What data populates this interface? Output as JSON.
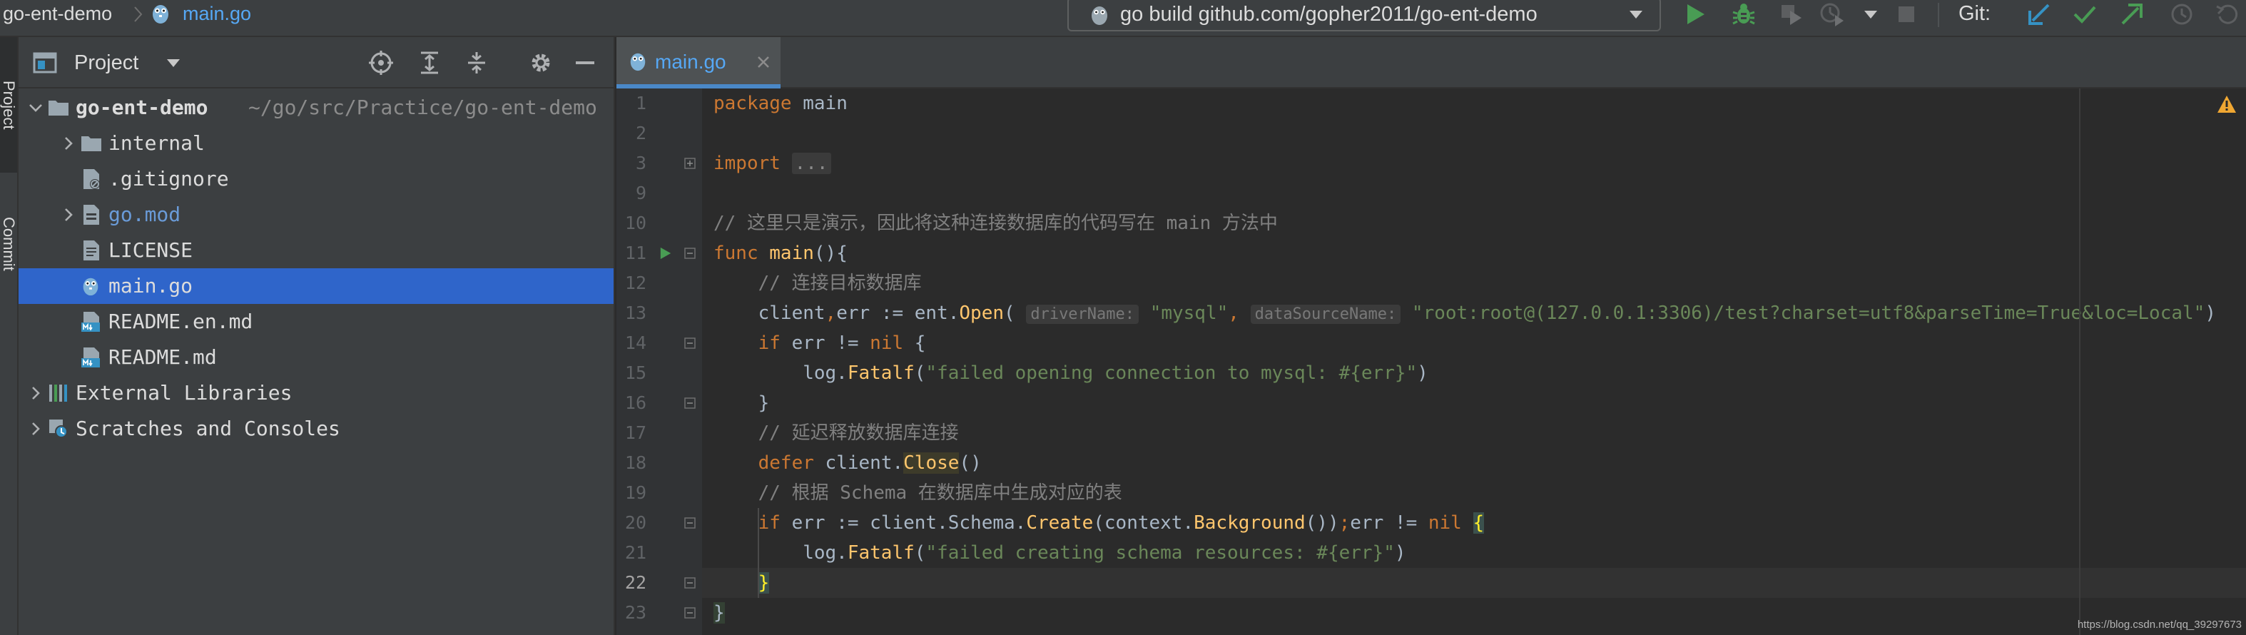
{
  "topbar": {
    "project_crumb": "go-ent-demo",
    "file_crumb": "main.go",
    "run_config": "go build github.com/gopher2011/go-ent-demo",
    "vcs_label": "Git:"
  },
  "tool_stripe": {
    "project_tab": "Project",
    "commit_tab": "Commit"
  },
  "project_panel": {
    "title": "Project",
    "tree": [
      {
        "label": "go-ent-demo",
        "path": "~/go/src/Practice/go-ent-demo",
        "icon": "folder-icon",
        "expandable": true,
        "expanded": true,
        "level": 0
      },
      {
        "label": "internal",
        "icon": "folder-icon",
        "expandable": true,
        "expanded": false,
        "level": 1
      },
      {
        "label": ".gitignore",
        "icon": "ignore-file-icon",
        "expandable": false,
        "level": 1
      },
      {
        "label": "go.mod",
        "icon": "go-mod-icon",
        "expandable": true,
        "expanded": false,
        "level": 1
      },
      {
        "label": "LICENSE",
        "icon": "text-file-icon",
        "expandable": false,
        "level": 1
      },
      {
        "label": "main.go",
        "icon": "gopher-file-icon",
        "expandable": false,
        "level": 1,
        "selected": true
      },
      {
        "label": "README.en.md",
        "icon": "markdown-icon",
        "expandable": false,
        "level": 1
      },
      {
        "label": "README.md",
        "icon": "markdown-icon",
        "expandable": false,
        "level": 1
      },
      {
        "label": "External Libraries",
        "icon": "libraries-icon",
        "expandable": true,
        "expanded": false,
        "level": 0
      },
      {
        "label": "Scratches and Consoles",
        "icon": "scratches-icon",
        "expandable": true,
        "expanded": false,
        "level": 0
      }
    ]
  },
  "editor": {
    "tab_label": "main.go",
    "current_line": "22",
    "lines": [
      {
        "no": "1",
        "segs": [
          [
            "kw",
            "package"
          ],
          [
            "",
            " main"
          ]
        ]
      },
      {
        "no": "2",
        "segs": []
      },
      {
        "no": "3",
        "segs": [
          [
            "kw",
            "import"
          ],
          [
            "",
            " "
          ],
          [
            "fold",
            "..."
          ]
        ]
      },
      {
        "no": "9",
        "segs": []
      },
      {
        "no": "10",
        "segs": [
          [
            "cmt",
            "// 这里只是演示，因此将这种连接数据库的代码写在 main 方法中"
          ]
        ]
      },
      {
        "no": "11",
        "segs": [
          [
            "kw",
            "func"
          ],
          [
            "",
            " "
          ],
          [
            "fn",
            "main"
          ],
          [
            "",
            "(){"
          ]
        ]
      },
      {
        "no": "12",
        "segs": [
          [
            "",
            "    "
          ],
          [
            "cmt",
            "// 连接目标数据库"
          ]
        ]
      },
      {
        "no": "13",
        "segs": [
          [
            "",
            "    client"
          ],
          [
            "kw",
            ","
          ],
          [
            "",
            "err := ent."
          ],
          [
            "fn",
            "Open"
          ],
          [
            "",
            "( "
          ],
          [
            "hint",
            "driverName:"
          ],
          [
            "",
            " "
          ],
          [
            "str",
            "\"mysql\""
          ],
          [
            "kw",
            ","
          ],
          [
            "",
            " "
          ],
          [
            "hint",
            "dataSourceName:"
          ],
          [
            "",
            " "
          ],
          [
            "str",
            "\"root:root@(127.0.0.1:3306)/test?charset=utf8&parseTime=True&loc=Local\""
          ],
          [
            "",
            ")"
          ]
        ]
      },
      {
        "no": "14",
        "segs": [
          [
            "",
            "    "
          ],
          [
            "kw",
            "if"
          ],
          [
            "",
            " err != "
          ],
          [
            "kw",
            "nil"
          ],
          [
            "",
            " {"
          ]
        ]
      },
      {
        "no": "15",
        "segs": [
          [
            "",
            "        log."
          ],
          [
            "fn",
            "Fatalf"
          ],
          [
            "",
            "("
          ],
          [
            "str",
            "\"failed opening connection to mysql: #{err}\""
          ],
          [
            "",
            ")"
          ]
        ]
      },
      {
        "no": "16",
        "segs": [
          [
            "",
            "    }"
          ]
        ]
      },
      {
        "no": "17",
        "segs": [
          [
            "",
            "    "
          ],
          [
            "cmt",
            "// 延迟释放数据库连接"
          ]
        ]
      },
      {
        "no": "18",
        "segs": [
          [
            "",
            "    "
          ],
          [
            "kw",
            "defer"
          ],
          [
            "",
            " client."
          ],
          [
            "fnhl",
            "Close"
          ],
          [
            "",
            "()"
          ]
        ]
      },
      {
        "no": "19",
        "segs": [
          [
            "",
            "    "
          ],
          [
            "cmt",
            "// 根据 Schema 在数据库中生成对应的表"
          ]
        ]
      },
      {
        "no": "20",
        "segs": [
          [
            "",
            "    "
          ],
          [
            "kw",
            "if"
          ],
          [
            "",
            " err := client.Schema."
          ],
          [
            "fn",
            "Create"
          ],
          [
            "",
            "(context."
          ],
          [
            "fn",
            "Background"
          ],
          [
            "",
            "())"
          ],
          [
            "kw",
            ";"
          ],
          [
            "",
            "err != "
          ],
          [
            "kw",
            "nil"
          ],
          [
            "",
            " "
          ],
          [
            "brace",
            "{"
          ]
        ]
      },
      {
        "no": "21",
        "segs": [
          [
            "",
            "        log."
          ],
          [
            "fn",
            "Fatalf"
          ],
          [
            "",
            "("
          ],
          [
            "str",
            "\"failed creating schema resources: #{err}\""
          ],
          [
            "",
            ")"
          ]
        ]
      },
      {
        "no": "22",
        "segs": [
          [
            "",
            "    "
          ],
          [
            "brace",
            "}"
          ]
        ]
      },
      {
        "no": "23",
        "segs": [
          [
            "close",
            "}"
          ]
        ]
      }
    ]
  },
  "watermark": "https://blog.csdn.net/qq_39297673",
  "colors": {
    "background": "#2b2b2b",
    "panel": "#3c3f41",
    "selection": "#2f65ca",
    "keyword": "#cc7832",
    "function": "#ffc66d",
    "string": "#6a8759",
    "comment": "#808080",
    "run_green": "#499c54"
  }
}
